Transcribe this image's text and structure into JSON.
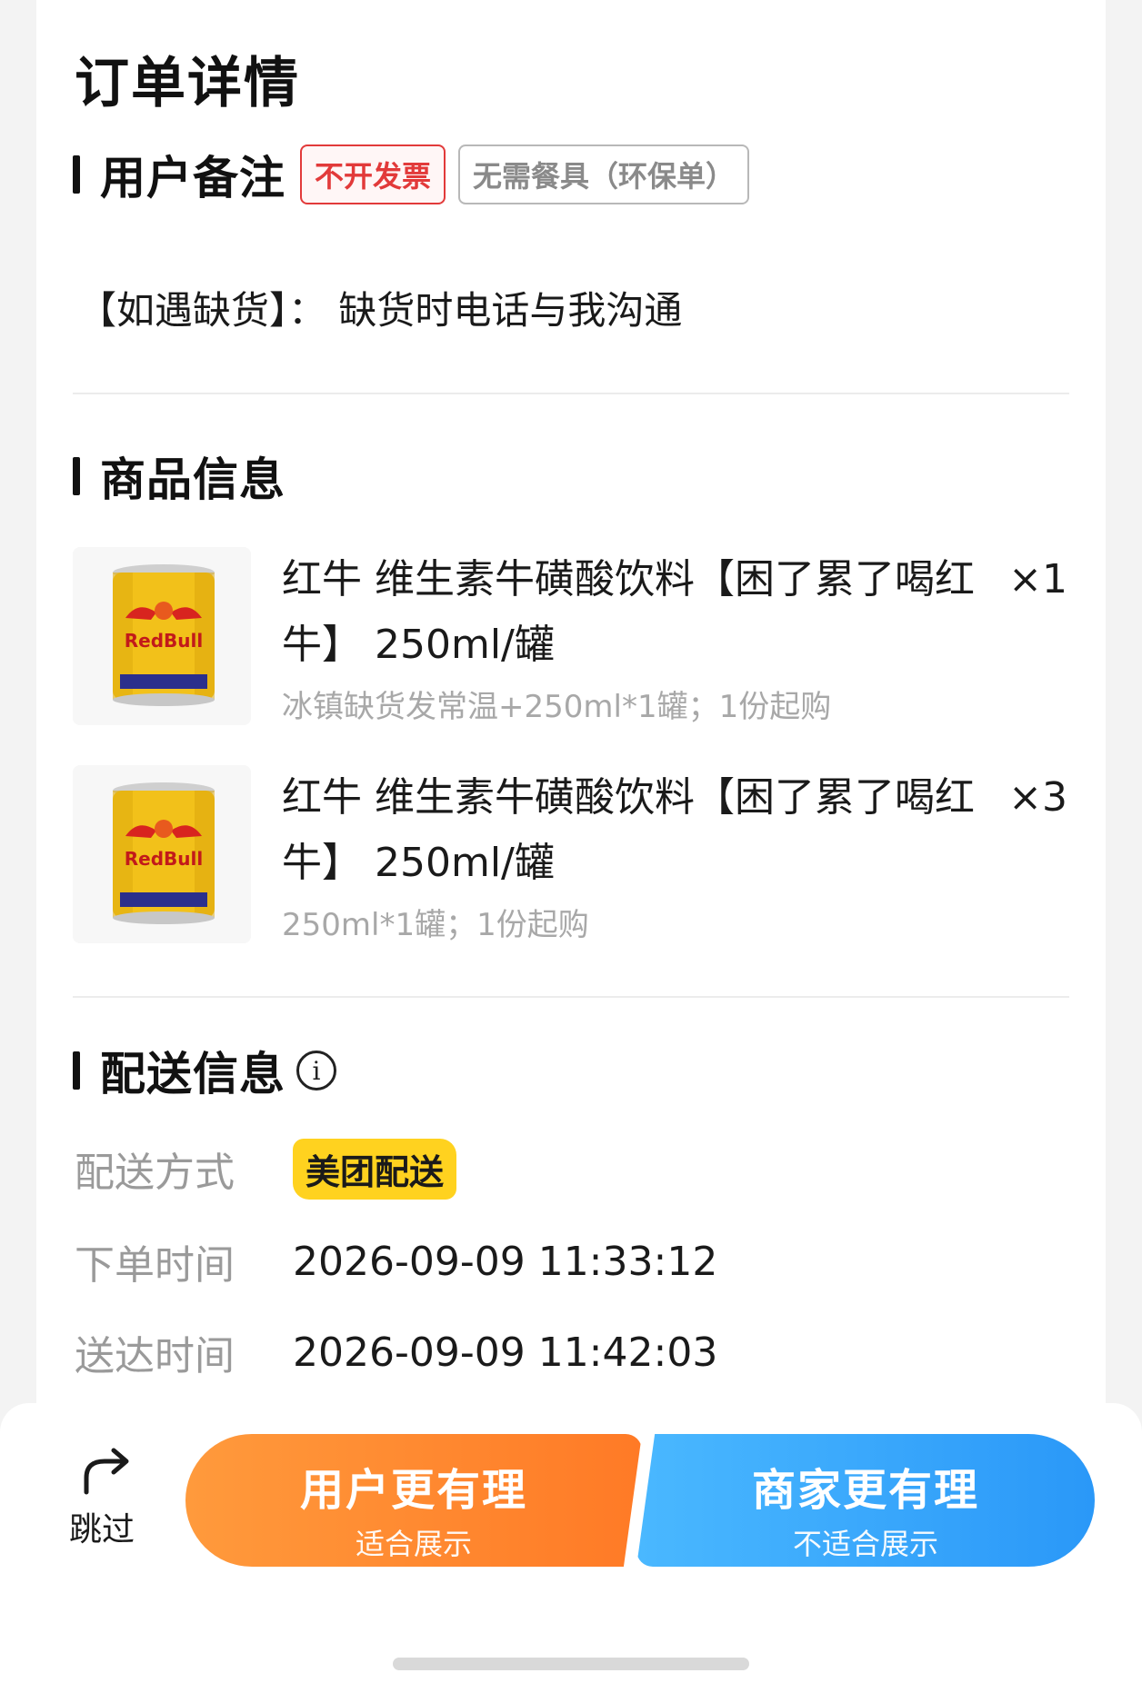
{
  "page": {
    "title": "订单详情"
  },
  "remarks": {
    "section_title": "用户备注",
    "tags": [
      "不开发票",
      "无需餐具（环保单）"
    ],
    "note": "【如遇缺货】：  缺货时电话与我沟通"
  },
  "products": {
    "section_title": "商品信息",
    "items": [
      {
        "name": "红牛 维生素牛磺酸饮料【困了累了喝红牛】 250ml/罐",
        "qty": "×1",
        "spec": "冰镇缺货发常温+250ml*1罐；1份起购",
        "image_icon": "red-bull-can-icon"
      },
      {
        "name": "红牛 维生素牛磺酸饮料【困了累了喝红牛】 250ml/罐",
        "qty": "×3",
        "spec": "250ml*1罐；1份起购",
        "image_icon": "red-bull-can-icon"
      }
    ]
  },
  "delivery": {
    "section_title": "配送信息",
    "info_icon": "i",
    "rows": [
      {
        "label": "配送方式",
        "value": "美团配送"
      },
      {
        "label": "下单时间",
        "value": "2026-09-09 11:33:12"
      },
      {
        "label": "送达时间",
        "value": "2026-09-09 11:42:03"
      }
    ]
  },
  "bottom": {
    "skip_label": "跳过",
    "left_vote": {
      "main": "用户更有理",
      "sub": "适合展示"
    },
    "right_vote": {
      "main": "商家更有理",
      "sub": "不适合展示"
    }
  },
  "colors": {
    "accent_red": "#e23a3a",
    "badge_yellow": "#ffd21f",
    "vote_orange": "#ff7a26",
    "vote_blue": "#2a98f8"
  }
}
